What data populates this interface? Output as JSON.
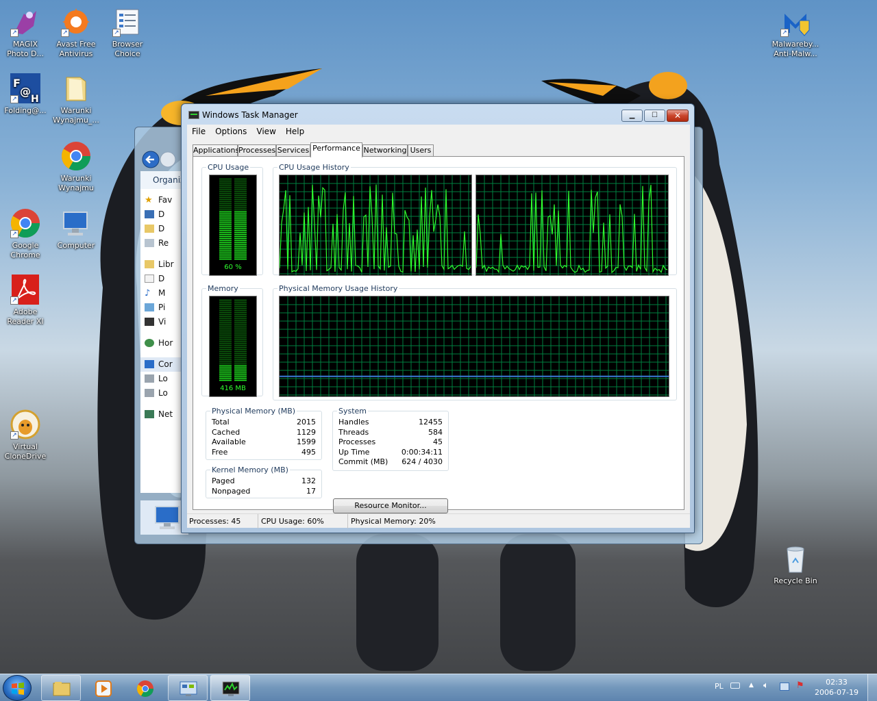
{
  "desktop": {
    "icons_left": [
      {
        "name": "magix",
        "line1": "MAGIX",
        "line2": "Photo D..."
      },
      {
        "name": "avast",
        "line1": "Avast Free",
        "line2": "Antivirus"
      },
      {
        "name": "browser-choice",
        "line1": "Browser",
        "line2": "Choice"
      },
      {
        "name": "folding",
        "line1": "Folding@...",
        "line2": ""
      },
      {
        "name": "warunki-folder",
        "line1": "Warunki",
        "line2": "Wynajmu_..."
      },
      {
        "name": "warunki-chrome",
        "line1": "Warunki",
        "line2": "Wynajmu"
      },
      {
        "name": "google-chrome",
        "line1": "Google",
        "line2": "Chrome"
      },
      {
        "name": "computer",
        "line1": "Computer",
        "line2": ""
      },
      {
        "name": "adobe-reader",
        "line1": "Adobe",
        "line2": "Reader XI"
      },
      {
        "name": "virtual-clonedrive",
        "line1": "Virtual",
        "line2": "CloneDrive"
      }
    ],
    "icon_malwarebytes": {
      "line1": "Malwareby...",
      "line2": "Anti-Malw..."
    },
    "icon_recycle": {
      "line1": "Recycle Bin"
    }
  },
  "explorer": {
    "organize": "Organiz",
    "pane_items": [
      "Fav",
      "D",
      "D",
      "Re",
      "Libr",
      "D",
      "M",
      "Pi",
      "Vi",
      "Hor",
      "Cor",
      "Lo",
      "Lo",
      "Net"
    ]
  },
  "taskmanager": {
    "title": "Windows Task Manager",
    "menu": [
      "File",
      "Options",
      "View",
      "Help"
    ],
    "tabs": [
      "Applications",
      "Processes",
      "Services",
      "Performance",
      "Networking",
      "Users"
    ],
    "active_tab": "Performance",
    "cpu_usage_label": "CPU Usage",
    "cpu_usage_value": "60 %",
    "cpu_usage_fraction": 0.6,
    "cpu_history_label": "CPU Usage History",
    "memory_label": "Memory",
    "memory_value": "416 MB",
    "memory_fraction": 0.2,
    "phys_history_label": "Physical Memory Usage History",
    "physical_memory": {
      "label": "Physical Memory (MB)",
      "rows": [
        {
          "k": "Total",
          "v": "2015"
        },
        {
          "k": "Cached",
          "v": "1129"
        },
        {
          "k": "Available",
          "v": "1599"
        },
        {
          "k": "Free",
          "v": "495"
        }
      ]
    },
    "kernel_memory": {
      "label": "Kernel Memory (MB)",
      "rows": [
        {
          "k": "Paged",
          "v": "132"
        },
        {
          "k": "Nonpaged",
          "v": "17"
        }
      ]
    },
    "system": {
      "label": "System",
      "rows": [
        {
          "k": "Handles",
          "v": "12455"
        },
        {
          "k": "Threads",
          "v": "584"
        },
        {
          "k": "Processes",
          "v": "45"
        },
        {
          "k": "Up Time",
          "v": "0:00:34:11"
        },
        {
          "k": "Commit (MB)",
          "v": "624 / 4030"
        }
      ]
    },
    "resource_monitor_button": "Resource Monitor...",
    "status": {
      "processes": "Processes: 45",
      "cpu": "CPU Usage: 60%",
      "memory": "Physical Memory: 20%"
    }
  },
  "taskbar": {
    "language": "PL",
    "time": "02:33",
    "date": "2006-07-19"
  },
  "colors": {
    "graph_grid": "#008040",
    "graph_line": "#2fff2f",
    "memory_line": "#3b7bd8"
  }
}
